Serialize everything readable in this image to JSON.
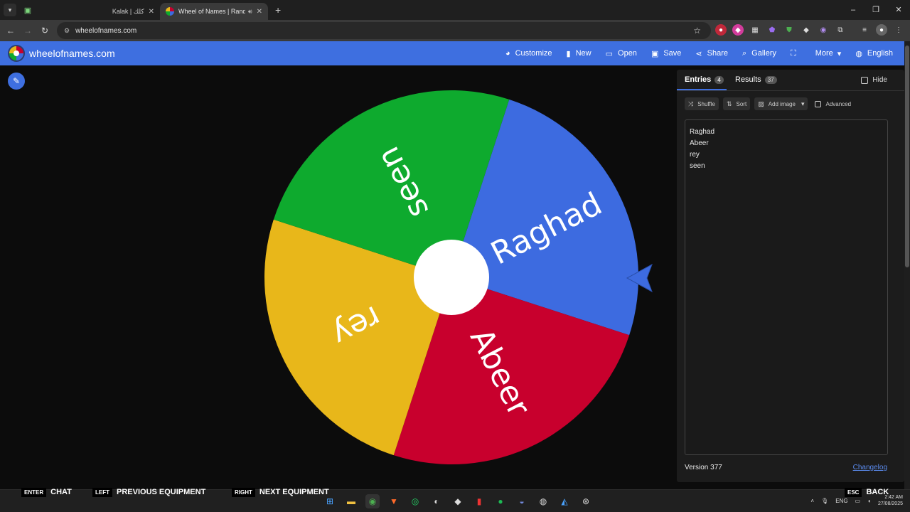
{
  "browser": {
    "tabs": [
      {
        "title": "Kalak | كلك"
      },
      {
        "title": "Wheel of Names | Random"
      }
    ],
    "url": "wheelofnames.com"
  },
  "app": {
    "brand": "wheelofnames.com",
    "menu": [
      {
        "label": "Customize",
        "icon": "palette-icon",
        "glyph": "◕"
      },
      {
        "label": "New",
        "icon": "file-icon",
        "glyph": "▮"
      },
      {
        "label": "Open",
        "icon": "folder-icon",
        "glyph": "▭"
      },
      {
        "label": "Save",
        "icon": "floppy-icon",
        "glyph": "▣"
      },
      {
        "label": "Share",
        "icon": "share-icon",
        "glyph": "⋖"
      },
      {
        "label": "Gallery",
        "icon": "search-icon",
        "glyph": "⌕"
      },
      {
        "label": "",
        "icon": "fullscreen-icon",
        "glyph": "⛶"
      },
      {
        "label": "More",
        "icon": "chevron-down-icon",
        "glyph": "▾"
      },
      {
        "label": "English",
        "icon": "globe-icon",
        "glyph": "◍"
      }
    ]
  },
  "wheel": {
    "segments": [
      {
        "name": "Raghad",
        "color": "#3d6be0"
      },
      {
        "name": "Abeer",
        "color": "#c8002d"
      },
      {
        "name": "rey",
        "color": "#e8b71a"
      },
      {
        "name": "seen",
        "color": "#0eaa2e"
      }
    ]
  },
  "panel": {
    "tabs": {
      "entries_label": "Entries",
      "entries_count": "4",
      "results_label": "Results",
      "results_count": "37"
    },
    "hide_label": "Hide",
    "tools": {
      "shuffle": "Shuffle",
      "sort": "Sort",
      "add_image": "Add image",
      "advanced": "Advanced"
    },
    "entries": [
      "Raghad",
      "Abeer",
      "rey",
      "seen"
    ],
    "version": "Version 377",
    "changelog": "Changelog"
  },
  "overlay_hints": [
    {
      "key": "ENTER",
      "label": "CHAT"
    },
    {
      "key": "LEFT",
      "label": "PREVIOUS EQUIPMENT"
    },
    {
      "key": "RIGHT",
      "label": "NEXT EQUIPMENT"
    },
    {
      "key": "ESC",
      "label": "BACK"
    }
  ],
  "taskbar": {
    "lang": "ENG",
    "time": "2:42 AM",
    "date": "27/08/2025"
  }
}
